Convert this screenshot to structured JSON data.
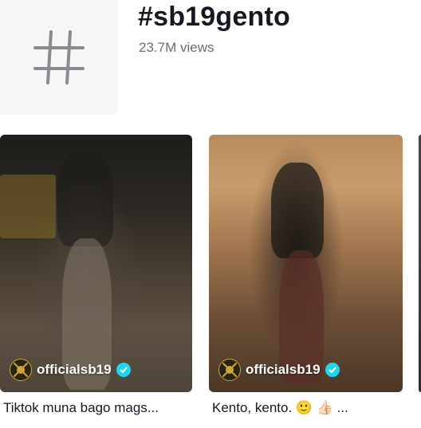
{
  "hashtag": {
    "title": "#sb19gento",
    "views": "23.7M views",
    "icon": "hashtag-icon"
  },
  "videos": [
    {
      "author": "officialsb19",
      "verified": true,
      "caption": "Tiktok muna bago mags...",
      "avatar_icon": "sb19-logo-icon"
    },
    {
      "author": "officialsb19",
      "verified": true,
      "caption": "Kento, kento. 🙂 👍🏻 ...",
      "avatar_icon": "sb19-logo-icon"
    }
  ],
  "colors": {
    "verified_badge": "#20d5ec",
    "title_text": "#161823",
    "secondary_text": "#6b6c72",
    "avatar_bg": "#f6f6f6"
  }
}
